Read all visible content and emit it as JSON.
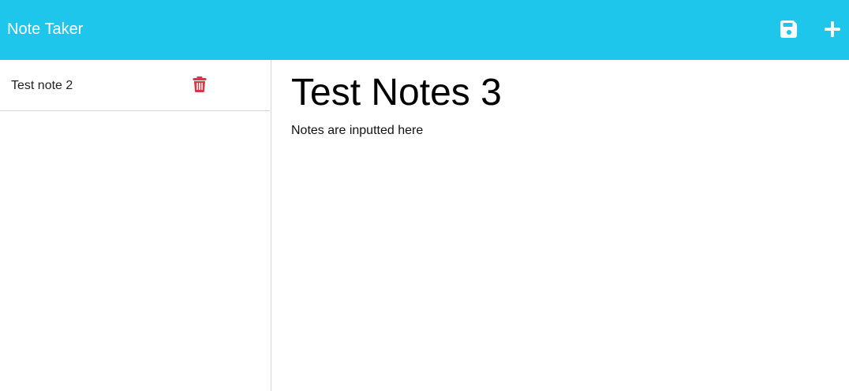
{
  "header": {
    "brand": "Note Taker",
    "save_icon": "floppy-disk-icon",
    "new_icon": "plus-icon",
    "background_color": "#1ec6ec"
  },
  "sidebar": {
    "items": [
      {
        "title": "Test note 2",
        "delete_icon": "trash-can-icon",
        "delete_color": "#dc3545"
      }
    ]
  },
  "editor": {
    "title": "Test Notes 3",
    "text": "Notes are inputted here"
  }
}
